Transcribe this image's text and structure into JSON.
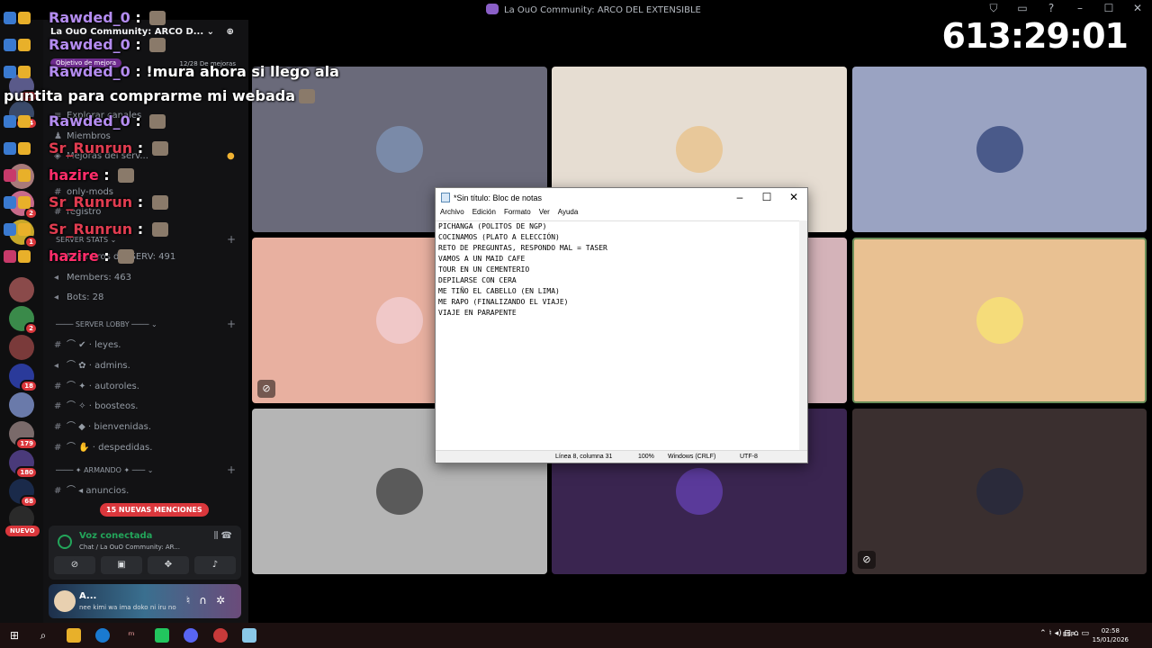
{
  "window_title": "La OuO Community: ARCO DEL EXTENSIBLE",
  "timer": "613:29:01",
  "server_list": {
    "badges": [
      "12",
      "124",
      "2",
      "2",
      "1",
      "18",
      "179",
      "180",
      "68"
    ],
    "new_label": "NUEVO"
  },
  "sidebar": {
    "server_name": "La OuO Community: ARCO D...",
    "boost_goal": "Objetivo de mejora",
    "boost_count": "12/28 De mejoras",
    "top_items": [
      "Explorar canales",
      "Miembros",
      "Mejoras del serv..."
    ],
    "channels_a": [
      "only-mods",
      "registro"
    ],
    "stats_category": "SERVER STATS",
    "stats": [
      "Miembros del SERV: 491",
      "Members: 463",
      "Bots: 28"
    ],
    "lobby_category": "SERVER LOBBY",
    "lobby_channels": [
      "leyes.",
      "admins.",
      "autoroles.",
      "boosteos.",
      "bienvenidas.",
      "despedidas."
    ],
    "armando_category": "ARMANDO",
    "armando_channels": [
      "anuncios."
    ],
    "mentions": "15 NUEVAS MENCIONES"
  },
  "voice_panel": {
    "status": "Voz conectada",
    "channel": "Chat  / La OuO Community: AR..."
  },
  "user_panel": {
    "name": "A...",
    "status": "nee kimi wa ima doko ni iru no"
  },
  "chat": [
    {
      "user": "Rawded_0",
      "color": "purple",
      "text": ""
    },
    {
      "user": "Rawded_0",
      "color": "purple",
      "text": ""
    },
    {
      "user": "Rawded_0",
      "color": "purple",
      "text": "!mura ahora si llego ala"
    },
    {
      "user": "",
      "color": "none",
      "text": "puntita para comprarme mi webada"
    },
    {
      "user": "Rawded_0",
      "color": "purple",
      "text": ""
    },
    {
      "user": "Sr_Runrun",
      "color": "red",
      "text": ""
    },
    {
      "user": "hazire",
      "color": "pink",
      "text": ""
    },
    {
      "user": "Sr_Runrun",
      "color": "red",
      "text": ""
    },
    {
      "user": "Sr_Runrun",
      "color": "red",
      "text": ""
    },
    {
      "user": "hazire",
      "color": "pink",
      "text": ""
    }
  ],
  "colors": {
    "tile_1": "#6a6a7a",
    "tile_2": "#e6ddd2",
    "tile_3": "#9aa3c2",
    "tile_4": "#e8b0a0",
    "tile_5": "#d4b3b9",
    "tile_6": "#e9c192",
    "tile_7": "#b5b5b5",
    "tile_8": "#3a2550",
    "tile_9": "#3a2f2f"
  },
  "notepad": {
    "title": "*Sin título: Bloc de notas",
    "menu": [
      "Archivo",
      "Edición",
      "Formato",
      "Ver",
      "Ayuda"
    ],
    "lines": [
      "PICHANGA (POLITOS DE NGP)",
      "COCINAMOS (PLATO A ELECCIÓN)",
      "RETO DE PREGUNTAS, RESPONDO MAL = TASER",
      "VAMOS A UN MAID CAFE",
      "TOUR EN UN CEMENTERIO",
      "DEPILARSE CON CERA",
      "ME TIÑO EL CABELLO (EN LIMA)",
      "ME RAPO (FINALIZANDO EL VIAJE)",
      "VIAJE EN PARAPENTE"
    ],
    "status": {
      "position": "Línea 8, columna 31",
      "zoom": "100%",
      "eol": "Windows (CRLF)",
      "encoding": "UTF-8"
    }
  },
  "taskbar": {
    "lang": "ESP",
    "time": "02:58",
    "date": "15/01/2026"
  }
}
